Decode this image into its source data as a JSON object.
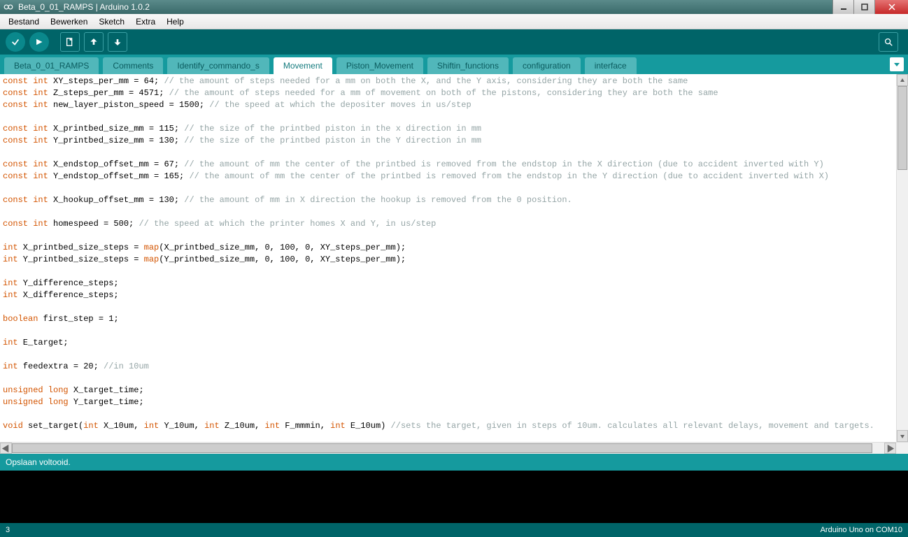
{
  "window": {
    "title": "Beta_0_01_RAMPS | Arduino 1.0.2"
  },
  "menu": {
    "items": [
      "Bestand",
      "Bewerken",
      "Sketch",
      "Extra",
      "Help"
    ]
  },
  "toolbar": {
    "verify": "verify",
    "upload": "upload",
    "new": "new",
    "open": "open",
    "save": "save",
    "serial": "serial-monitor"
  },
  "tabs": {
    "items": [
      {
        "label": "Beta_0_01_RAMPS",
        "active": false
      },
      {
        "label": "Comments",
        "active": false
      },
      {
        "label": "Identify_commando_s",
        "active": false
      },
      {
        "label": "Movement",
        "active": true
      },
      {
        "label": "Piston_Movement",
        "active": false
      },
      {
        "label": "Shiftin_functions",
        "active": false
      },
      {
        "label": "configuration",
        "active": false
      },
      {
        "label": "interface",
        "active": false
      }
    ]
  },
  "code": {
    "lines": [
      {
        "t": "decl",
        "kw": "const int",
        "name": "XY_steps_per_mm",
        "val": "64",
        "cm": "// the amount of steps needed for a mm on both the X, and the Y axis, considering they are both the same"
      },
      {
        "t": "decl",
        "kw": "const int",
        "name": "Z_steps_per_mm",
        "val": "4571",
        "cm": "// the amount of steps needed for a mm of movement on both of the pistons, considering they are both the same"
      },
      {
        "t": "decl",
        "kw": "const int",
        "name": "new_layer_piston_speed",
        "val": "1500",
        "cm": "// the speed at which the depositer moves in us/step"
      },
      {
        "t": "blank"
      },
      {
        "t": "decl",
        "kw": "const int",
        "name": "X_printbed_size_mm",
        "val": "115",
        "cm": "// the size of the printbed piston in the x direction in mm"
      },
      {
        "t": "decl",
        "kw": "const int",
        "name": "Y_printbed_size_mm",
        "val": "130",
        "cm": "// the size of the printbed piston in the Y direction in mm"
      },
      {
        "t": "blank"
      },
      {
        "t": "decl",
        "kw": "const int",
        "name": "X_endstop_offset_mm",
        "val": "67",
        "cm": "// the amount of mm the center of the printbed is removed from the endstop in the X direction (due to accident inverted with Y)"
      },
      {
        "t": "decl",
        "kw": "const int",
        "name": "Y_endstop_offset_mm",
        "val": "165",
        "cm": "// the amount of mm the center of the printbed is removed from the endstop in the Y direction (due to accident inverted with X)"
      },
      {
        "t": "blank"
      },
      {
        "t": "decl",
        "kw": "const int",
        "name": "X_hookup_offset_mm",
        "val": "130",
        "cm": "// the amount of mm in X direction the hookup is removed from the 0 position."
      },
      {
        "t": "blank"
      },
      {
        "t": "decl",
        "kw": "const int",
        "name": "homespeed",
        "val": "500",
        "cm": "// the speed at which the printer homes X and Y, in us/step"
      },
      {
        "t": "blank"
      },
      {
        "t": "map",
        "kw": "int",
        "name": "X_printbed_size_steps",
        "arg": "X_printbed_size_mm"
      },
      {
        "t": "map",
        "kw": "int",
        "name": "Y_printbed_size_steps",
        "arg": "Y_printbed_size_mm"
      },
      {
        "t": "blank"
      },
      {
        "t": "simple",
        "kw": "int",
        "rest": "Y_difference_steps;"
      },
      {
        "t": "simple",
        "kw": "int",
        "rest": "X_difference_steps;"
      },
      {
        "t": "blank"
      },
      {
        "t": "simple",
        "kw": "boolean",
        "rest": "first_step = 1;"
      },
      {
        "t": "blank"
      },
      {
        "t": "simple",
        "kw": "int",
        "rest": "E_target;"
      },
      {
        "t": "blank"
      },
      {
        "t": "declcm",
        "kw": "int",
        "rest": "feedextra = 20;",
        "cm": "//in 10um"
      },
      {
        "t": "blank"
      },
      {
        "t": "simple",
        "kw": "unsigned long",
        "rest": "X_target_time;"
      },
      {
        "t": "simple",
        "kw": "unsigned long",
        "rest": "Y_target_time;"
      },
      {
        "t": "blank"
      },
      {
        "t": "func"
      }
    ],
    "func_sig": {
      "ret": "void",
      "name": "set_target",
      "params": [
        {
          "kw": "int",
          "n": "X_10um"
        },
        {
          "kw": "int",
          "n": "Y_10um"
        },
        {
          "kw": "int",
          "n": "Z_10um"
        },
        {
          "kw": "int",
          "n": "F_mmmin"
        },
        {
          "kw": "int",
          "n": "E_10um"
        }
      ],
      "cm": "//sets the target, given in steps of 10um. calculates all relevant delays, movement and targets."
    },
    "map_tail": ", 0, 100, 0, XY_steps_per_mm);"
  },
  "status": {
    "text": "Opslaan voltooid."
  },
  "footer": {
    "line": "3",
    "board": "Arduino Uno on COM10"
  }
}
